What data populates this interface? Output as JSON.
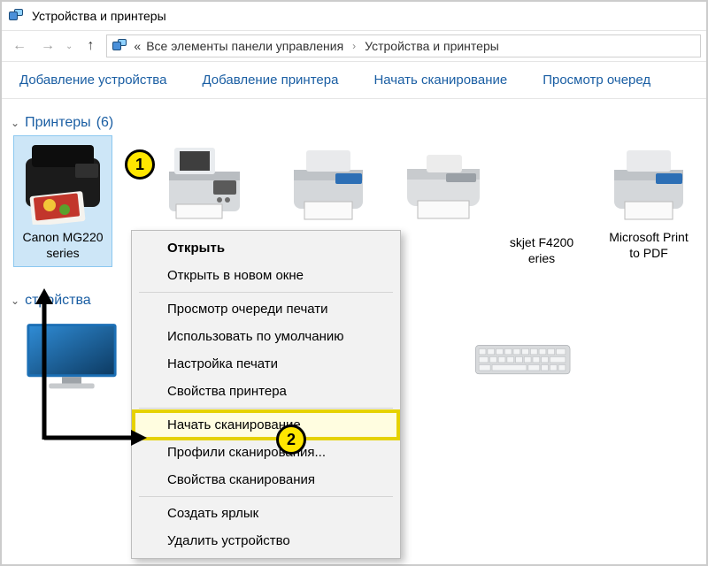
{
  "window": {
    "title": "Устройства и принтеры"
  },
  "breadcrumb": {
    "prefix": "«",
    "segment1": "Все элементы панели управления",
    "segment2": "Устройства и принтеры"
  },
  "toolbar": {
    "add_device": "Добавление устройства",
    "add_printer": "Добавление принтера",
    "start_scan": "Начать сканирование",
    "view_queue": "Просмотр очеред"
  },
  "groups": {
    "printers": {
      "label": "Принтеры",
      "count": "(6)"
    },
    "devices": {
      "label": "стройства"
    }
  },
  "printers": [
    {
      "name": "Canon MG220\nseries"
    },
    {
      "name": ""
    },
    {
      "name": ""
    },
    {
      "name": ""
    },
    {
      "name": "skjet F4200\neries"
    },
    {
      "name": "Microsoft Print\nto PDF"
    }
  ],
  "context_menu": {
    "open": "Открыть",
    "open_new_window": "Открыть в новом окне",
    "view_queue": "Просмотр очереди печати",
    "set_default": "Использовать по умолчанию",
    "print_settings": "Настройка печати",
    "printer_props": "Свойства принтера",
    "start_scan": "Начать сканирование",
    "scan_profiles": "Профили сканирования...",
    "scan_props": "Свойства сканирования",
    "create_shortcut": "Создать ярлык",
    "delete_device": "Удалить устройство"
  },
  "annotations": {
    "badge1": "1",
    "badge2": "2"
  }
}
